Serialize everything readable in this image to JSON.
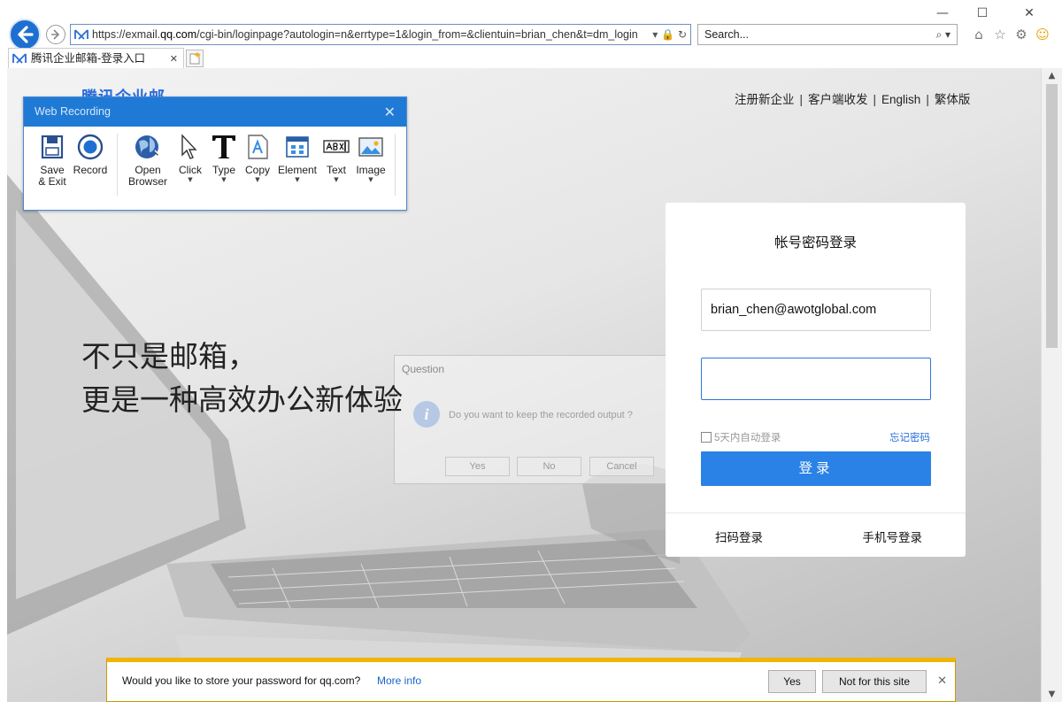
{
  "browser": {
    "url_prefix": "https://exmail.",
    "url_host": "qq.com",
    "url_path": "/cgi-bin/loginpage?autologin=n&errtype=1&login_from=&clientuin=brian_chen&t=dm_login",
    "search_placeholder": "Search...",
    "tab_title": "腾讯企业邮箱-登录入口",
    "window_buttons": {
      "minimize": "—",
      "maximize": "☐",
      "close": "✕"
    }
  },
  "header": {
    "logo_text": "腾讯企业邮",
    "links": [
      "注册新企业",
      "客户端收发",
      "English",
      "繁体版"
    ],
    "separator": "|"
  },
  "slogan": {
    "line1": "不只是邮箱，",
    "line2": "更是一种高效办公新体验"
  },
  "login": {
    "title": "帐号密码登录",
    "email_value": "brian_chen@awotglobal.com",
    "password_value": "",
    "remember_label": "5天内自动登录",
    "forgot_label": "忘记密码",
    "submit_label": "登录",
    "qr_label": "扫码登录",
    "phone_label": "手机号登录"
  },
  "recorder": {
    "title": "Web Recording",
    "tools": [
      {
        "line1": "Save",
        "line2": "& Exit",
        "icon": "save-icon"
      },
      {
        "line1": "Record",
        "line2": "",
        "icon": "record-icon"
      },
      {
        "line1": "Open",
        "line2": "Browser",
        "icon": "globe-icon"
      },
      {
        "line1": "Click",
        "line2": "",
        "icon": "cursor-icon"
      },
      {
        "line1": "Type",
        "line2": "",
        "icon": "type-icon"
      },
      {
        "line1": "Copy",
        "line2": "",
        "icon": "copy-icon"
      },
      {
        "line1": "Element",
        "line2": "",
        "icon": "element-icon"
      },
      {
        "line1": "Text",
        "line2": "",
        "icon": "text-icon"
      },
      {
        "line1": "Image",
        "line2": "",
        "icon": "image-icon"
      }
    ]
  },
  "question_dialog": {
    "title": "Question",
    "message": "Do you want to keep the recorded output ?",
    "yes": "Yes",
    "no": "No",
    "cancel": "Cancel"
  },
  "password_bar": {
    "message": "Would you like to store your password for qq.com?",
    "more_info": "More info",
    "yes": "Yes",
    "not_for_site": "Not for this site"
  },
  "colors": {
    "accent": "#2a82e6",
    "recorder_header": "#1f7ad6",
    "notification": "#f1b400"
  }
}
